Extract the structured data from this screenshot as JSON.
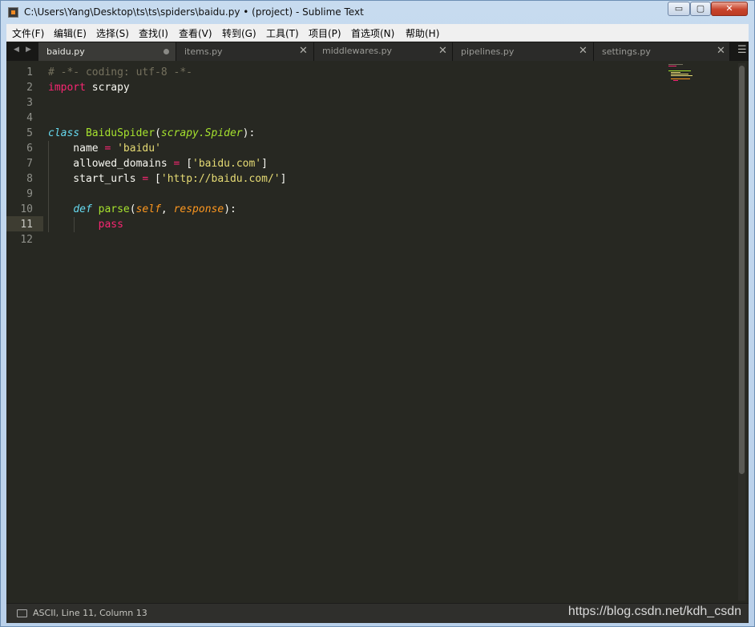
{
  "window": {
    "title": "C:\\Users\\Yang\\Desktop\\ts\\ts\\spiders\\baidu.py • (project) - Sublime Text",
    "controls": {
      "minimize": "▭",
      "maximize": "▢",
      "close": "✕"
    }
  },
  "menu": [
    "文件(F)",
    "编辑(E)",
    "选择(S)",
    "查找(I)",
    "查看(V)",
    "转到(G)",
    "工具(T)",
    "项目(P)",
    "首选项(N)",
    "帮助(H)"
  ],
  "tabs": {
    "nav_prev": "◀",
    "nav_next": "▶",
    "items": [
      {
        "label": "baidu.py",
        "active": true,
        "modified": true
      },
      {
        "label": "items.py",
        "active": false,
        "modified": false
      },
      {
        "label": "middlewares.py",
        "active": false,
        "modified": false
      },
      {
        "label": "pipelines.py",
        "active": false,
        "modified": false
      },
      {
        "label": "settings.py",
        "active": false,
        "modified": false
      }
    ],
    "close_glyph": "✕",
    "menu_glyph": "☰"
  },
  "editor": {
    "current_line": 11,
    "line_numbers": [
      "1",
      "2",
      "3",
      "4",
      "5",
      "6",
      "7",
      "8",
      "9",
      "10",
      "11",
      "12"
    ],
    "lines": [
      {
        "tokens": [
          {
            "t": "# -*- coding: utf-8 -*-",
            "c": "comment"
          }
        ]
      },
      {
        "tokens": [
          {
            "t": "import",
            "c": "kw"
          },
          {
            "t": " scrapy",
            "c": ""
          }
        ]
      },
      {
        "tokens": []
      },
      {
        "tokens": []
      },
      {
        "tokens": [
          {
            "t": "class",
            "c": "storage"
          },
          {
            "t": " ",
            "c": ""
          },
          {
            "t": "BaiduSpider",
            "c": "class"
          },
          {
            "t": "(",
            "c": ""
          },
          {
            "t": "scrapy.Spider",
            "c": "inherit"
          },
          {
            "t": "):",
            "c": ""
          }
        ]
      },
      {
        "tokens": [
          {
            "t": "    name ",
            "c": ""
          },
          {
            "t": "=",
            "c": "op"
          },
          {
            "t": " ",
            "c": ""
          },
          {
            "t": "'baidu'",
            "c": "str"
          }
        ]
      },
      {
        "tokens": [
          {
            "t": "    allowed_domains ",
            "c": ""
          },
          {
            "t": "=",
            "c": "op"
          },
          {
            "t": " [",
            "c": ""
          },
          {
            "t": "'baidu.com'",
            "c": "str"
          },
          {
            "t": "]",
            "c": ""
          }
        ]
      },
      {
        "tokens": [
          {
            "t": "    start_urls ",
            "c": ""
          },
          {
            "t": "=",
            "c": "op"
          },
          {
            "t": " [",
            "c": ""
          },
          {
            "t": "'http://baidu.com/'",
            "c": "str"
          },
          {
            "t": "]",
            "c": ""
          }
        ]
      },
      {
        "tokens": []
      },
      {
        "tokens": [
          {
            "t": "    ",
            "c": ""
          },
          {
            "t": "def",
            "c": "storage"
          },
          {
            "t": " ",
            "c": ""
          },
          {
            "t": "parse",
            "c": "class"
          },
          {
            "t": "(",
            "c": ""
          },
          {
            "t": "self",
            "c": "param"
          },
          {
            "t": ", ",
            "c": ""
          },
          {
            "t": "response",
            "c": "param"
          },
          {
            "t": "):",
            "c": ""
          }
        ]
      },
      {
        "tokens": [
          {
            "t": "        ",
            "c": ""
          },
          {
            "t": "pass",
            "c": "kw"
          }
        ]
      },
      {
        "tokens": []
      }
    ]
  },
  "status": {
    "text": "ASCII, Line 11, Column 13",
    "watermark": "https://blog.csdn.net/kdh_csdn"
  },
  "colors": {
    "editor_bg": "#272822",
    "keyword": "#f92672",
    "storage": "#66d9ef",
    "entity": "#a6e22e",
    "string": "#e6db74",
    "parameter": "#fd971f",
    "comment": "#75715e"
  }
}
